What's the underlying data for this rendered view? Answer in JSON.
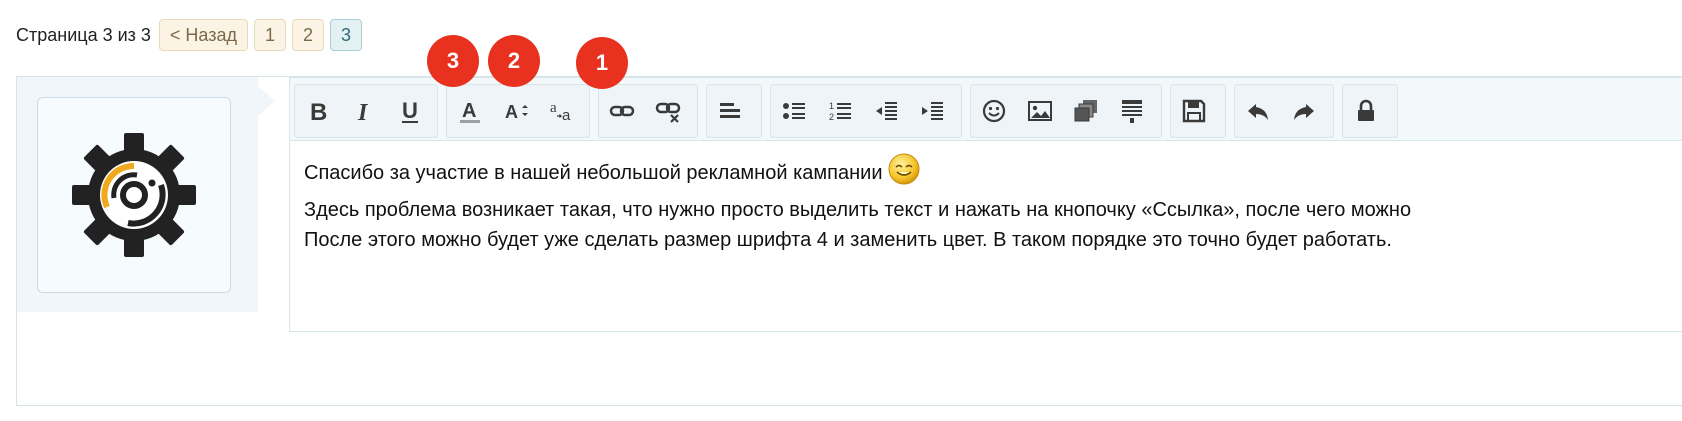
{
  "pagination": {
    "label": "Страница 3 из 3",
    "prev_label": "< Назад",
    "pages": [
      "1",
      "2",
      "3"
    ],
    "current_page": "3"
  },
  "toolbar": {
    "groups": [
      [
        "bold-icon",
        "italic-icon",
        "underline-icon"
      ],
      [
        "text-color-icon",
        "font-size-icon",
        "font-family-icon"
      ],
      [
        "link-icon",
        "unlink-icon"
      ],
      [
        "align-icon"
      ],
      [
        "bullet-list-icon",
        "numbered-list-icon",
        "outdent-icon",
        "indent-icon"
      ],
      [
        "smile-icon",
        "image-icon",
        "media-icon",
        "template-icon"
      ],
      [
        "save-icon"
      ],
      [
        "undo-icon",
        "redo-icon"
      ],
      [
        "lock-icon"
      ]
    ]
  },
  "content": {
    "lines": [
      "Спасибо за участие в нашей небольшой рекламной кампании",
      "Здесь проблема возникает такая, что нужно просто выделить текст и нажать на кнопочку «Ссылка», после чего можно",
      "После этого можно будет уже сделать размер шрифта 4 и заменить цвет. В таком порядке это точно будет работать."
    ]
  },
  "markers": [
    "3",
    "2",
    "1"
  ],
  "colors": {
    "marker": "#e8321f",
    "accent": "#f0a81c",
    "avatar_dark": "#222222"
  }
}
